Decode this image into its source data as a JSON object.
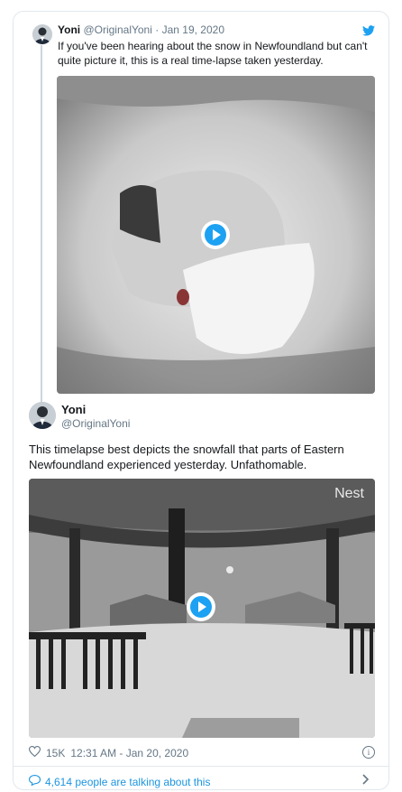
{
  "quoted_tweet": {
    "name": "Yoni",
    "handle": "@OriginalYoni",
    "separator": "·",
    "date": "Jan 19, 2020",
    "text": "If you've been hearing about the snow in Newfoundland but can't quite picture it, this is a real time-lapse taken yesterday."
  },
  "main_tweet": {
    "name": "Yoni",
    "handle": "@OriginalYoni",
    "text": "This timelapse best depicts the snowfall that parts of Eastern Newfoundland experienced yesterday. Unfathomable.",
    "video_overlay": "Nest",
    "likes": "15K",
    "timestamp": "12:31 AM - Jan 20, 2020"
  },
  "footer": {
    "talking": "4,614 people are talking about this"
  },
  "colors": {
    "accent": "#1da1f2",
    "link": "#1b95e0",
    "muted": "#657786",
    "border": "#e1e8ed"
  },
  "icons": [
    "twitter-bird-icon",
    "play-icon",
    "heart-icon",
    "info-icon",
    "speech-bubble-icon",
    "chevron-right-icon"
  ]
}
